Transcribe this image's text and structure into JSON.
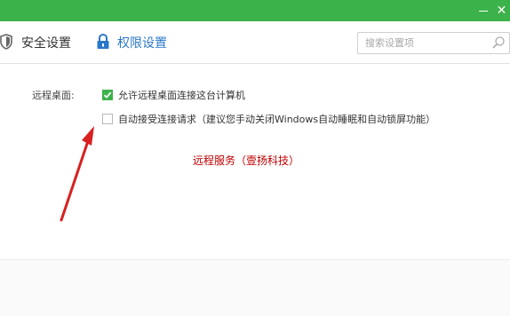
{
  "window": {
    "minimize_icon": "minimize-icon",
    "close_icon": "close-icon",
    "close_glyph": "✕",
    "titlebar_color": "#3cb24a"
  },
  "toolbar": {
    "security_tab": {
      "label": "安全设置",
      "icon": "shield-icon"
    },
    "permission_tab": {
      "label": "权限设置",
      "icon": "lock-icon",
      "active_color": "#2b78c8"
    },
    "search": {
      "placeholder": "搜索设置项",
      "icon": "search-icon"
    }
  },
  "remote_desktop": {
    "label": "远程桌面:",
    "allow_remote": {
      "label": "允许远程桌面连接这台计算机",
      "checked": true
    },
    "auto_accept": {
      "label": "自动接受连接请求（建议您手动关闭Windows自动睡眠和自动锁屏功能）",
      "checked": false
    }
  },
  "annotation": {
    "text": "远程服务（壹扬科技）",
    "color": "#c00000",
    "arrow_icon": "red-arrow-icon"
  }
}
